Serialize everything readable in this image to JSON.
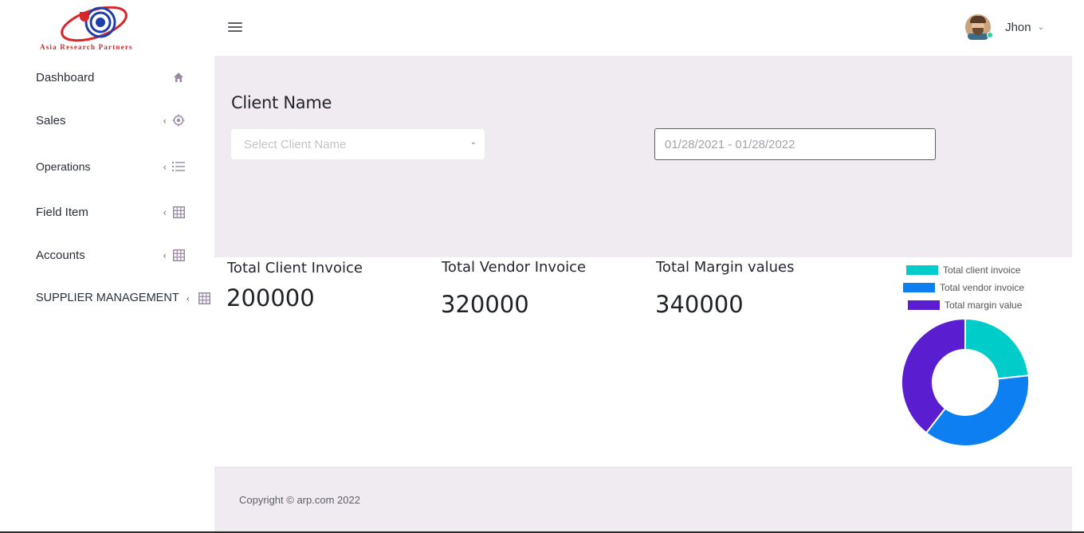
{
  "brand": {
    "logo_text": "Asia Research Partners"
  },
  "sidebar": {
    "items": [
      {
        "label": "Dashboard",
        "icon": "home-icon"
      },
      {
        "label": "Sales",
        "icon": "crosshair-icon"
      },
      {
        "label": "Operations",
        "icon": "list-icon"
      },
      {
        "label": "Field Item",
        "icon": "grid-icon"
      },
      {
        "label": "Accounts",
        "icon": "grid-icon"
      },
      {
        "label": "SUPPLIER MANAGEMENT",
        "icon": "grid-icon"
      }
    ]
  },
  "header": {
    "user_name": "Jhon"
  },
  "filters": {
    "title": "Client Name",
    "client_placeholder": "Select Client Name",
    "date_range": "01/28/2021 - 01/28/2022"
  },
  "stats": [
    {
      "label": "Total Client Invoice",
      "value": "200000"
    },
    {
      "label": "Total Vendor Invoice",
      "value": "320000"
    },
    {
      "label": "Total Margin values",
      "value": "340000"
    }
  ],
  "chart_data": {
    "type": "pie",
    "subtype": "doughnut",
    "categories": [
      "Total client invoice",
      "Total vendor invoice",
      "Total margin value"
    ],
    "values": [
      200000,
      320000,
      340000
    ],
    "colors": [
      "#00ccc9",
      "#0d7ff0",
      "#5a1ed0"
    ],
    "legend_position": "top"
  },
  "footer": {
    "copyright": "Copyright © arp.com 2022"
  }
}
